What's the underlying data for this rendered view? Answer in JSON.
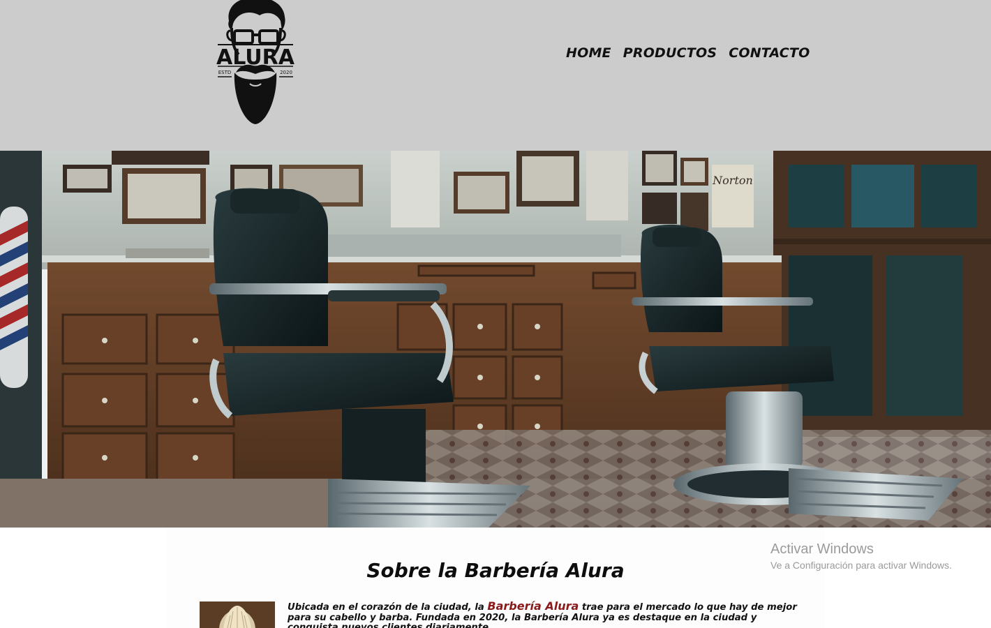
{
  "header": {
    "logo": {
      "brand": "ALURA",
      "est_label": "ESTD",
      "year": "2020",
      "icon": "bearded-man-logo"
    },
    "nav": [
      {
        "label": "HOME"
      },
      {
        "label": "PRODUCTOS"
      },
      {
        "label": "CONTACTO"
      }
    ],
    "background": "#cccccc"
  },
  "hero": {
    "image": "barbershop-interior-photo",
    "sign_text": "Norton"
  },
  "about": {
    "title": "Sobre la Barbería Alura",
    "text_before": "Ubicada en el corazón de la ciudad, la ",
    "brand": "Barbería Alura",
    "text_after": " trae para el mercado lo que hay de mejor para su cabello y barba. Fundada en 2020, la Barbería Alura ya es destaque en la ciudad y conquista nuevos clientes diariamente.",
    "brand_color": "#8b1a1a",
    "image": "shaving-brush-photo"
  },
  "watermark": {
    "title": "Activar Windows",
    "subtitle": "Ve a Configuración para activar Windows."
  }
}
